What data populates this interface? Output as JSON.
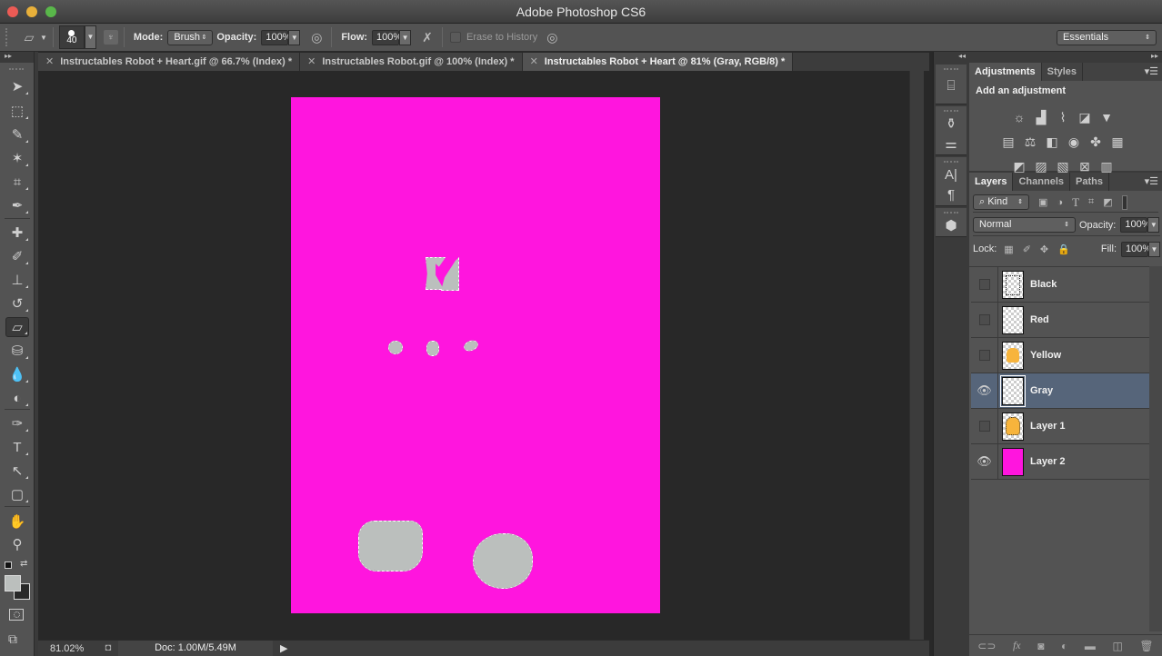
{
  "window": {
    "title": "Adobe Photoshop CS6",
    "traffic_lights": {
      "close": "#ec5b55",
      "minimize": "#e8b03a",
      "maximize": "#59b74a"
    }
  },
  "options_bar": {
    "tool_icon": "eraser-icon",
    "brush_size": "40",
    "mode_label": "Mode:",
    "mode_value": "Brush",
    "opacity_label": "Opacity:",
    "opacity_value": "100%",
    "flow_label": "Flow:",
    "flow_value": "100%",
    "erase_to_history_label": "Erase to History",
    "erase_to_history_checked": false,
    "workspace_value": "Essentials"
  },
  "tabs": [
    {
      "label": "Instructables Robot + Heart.gif @ 66.7% (Index) *",
      "active": false
    },
    {
      "label": "Instructables Robot.gif @ 100% (Index) *",
      "active": false
    },
    {
      "label": "Instructables Robot + Heart @ 81% (Gray, RGB/8) *",
      "active": true
    }
  ],
  "tools": [
    {
      "name": "move-tool",
      "glyph": "➤"
    },
    {
      "name": "marquee-tool",
      "glyph": "⬚"
    },
    {
      "name": "lasso-tool",
      "glyph": "✎"
    },
    {
      "name": "magic-wand-tool",
      "glyph": "✶"
    },
    {
      "name": "crop-tool",
      "glyph": "⌗"
    },
    {
      "name": "eyedropper-tool",
      "glyph": "✒"
    },
    {
      "name": "healing-brush-tool",
      "glyph": "✚"
    },
    {
      "name": "brush-tool",
      "glyph": "✐"
    },
    {
      "name": "clone-stamp-tool",
      "glyph": "⊥"
    },
    {
      "name": "history-brush-tool",
      "glyph": "↺"
    },
    {
      "name": "eraser-tool",
      "glyph": "▱",
      "active": true
    },
    {
      "name": "paint-bucket-tool",
      "glyph": "⛁"
    },
    {
      "name": "blur-tool",
      "glyph": "💧"
    },
    {
      "name": "dodge-tool",
      "glyph": "◐"
    },
    {
      "name": "pen-tool",
      "glyph": "✑"
    },
    {
      "name": "type-tool",
      "glyph": "T"
    },
    {
      "name": "path-selection-tool",
      "glyph": "↖"
    },
    {
      "name": "rectangle-tool",
      "glyph": "▢"
    },
    {
      "name": "hand-tool",
      "glyph": "✋"
    },
    {
      "name": "zoom-tool",
      "glyph": "⚲"
    }
  ],
  "colors": {
    "foreground": "#bbbfbd",
    "background": "#282828",
    "canvas_fill": "#ff15de",
    "selected_layer": "#56657a"
  },
  "status": {
    "zoom": "81.02%",
    "doc": "Doc: 1.00M/5.49M"
  },
  "adjustments_panel": {
    "tabs": [
      "Adjustments",
      "Styles"
    ],
    "heading": "Add an adjustment",
    "rows": [
      [
        "brightness-contrast-icon",
        "levels-icon",
        "curves-icon",
        "exposure-icon",
        "vibrance-icon"
      ],
      [
        "hue-saturation-icon",
        "color-balance-icon",
        "black-white-icon",
        "photo-filter-icon",
        "channel-mixer-icon",
        "color-lookup-icon"
      ],
      [
        "invert-icon",
        "posterize-icon",
        "threshold-icon",
        "selective-color-icon",
        "gradient-map-icon"
      ]
    ]
  },
  "layers_panel": {
    "tabs": [
      "Layers",
      "Channels",
      "Paths"
    ],
    "filter_label": "Kind",
    "blend_mode": "Normal",
    "opacity_label": "Opacity:",
    "opacity_value": "100%",
    "lock_label": "Lock:",
    "fill_label": "Fill:",
    "fill_value": "100%",
    "layers": [
      {
        "name": "Black",
        "visible": false,
        "selected": false,
        "thumb": "black-sketch"
      },
      {
        "name": "Red",
        "visible": false,
        "selected": false,
        "thumb": "transparent"
      },
      {
        "name": "Yellow",
        "visible": false,
        "selected": false,
        "thumb": "yellow"
      },
      {
        "name": "Gray",
        "visible": true,
        "selected": true,
        "thumb": "transparent"
      },
      {
        "name": "Layer 1",
        "visible": false,
        "selected": false,
        "thumb": "robot"
      },
      {
        "name": "Layer 2",
        "visible": true,
        "selected": false,
        "thumb": "magenta"
      }
    ]
  }
}
